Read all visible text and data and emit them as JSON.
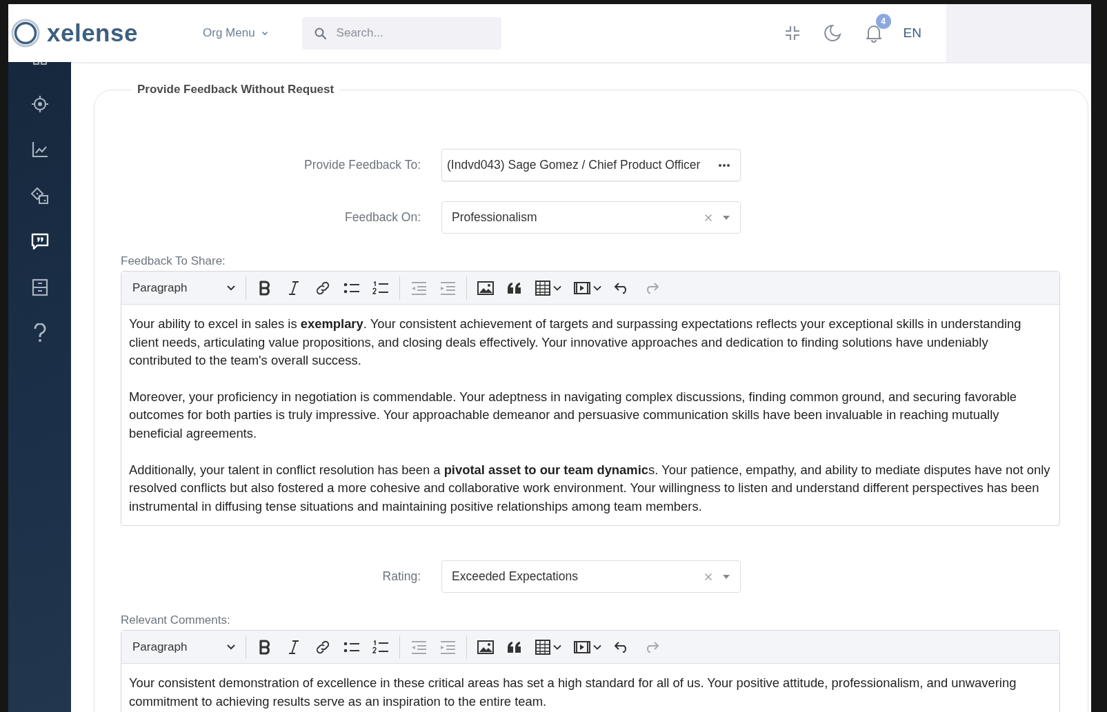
{
  "brand": {
    "name": "xelense"
  },
  "header": {
    "org_menu": "Org Menu",
    "search": {
      "placeholder": "Search..."
    },
    "notifications": {
      "count": "4"
    },
    "language": "EN"
  },
  "sidebar": {
    "items": [
      {
        "kind": "grid",
        "selected": false
      },
      {
        "kind": "target",
        "selected": false
      },
      {
        "kind": "chart",
        "selected": false
      },
      {
        "kind": "shapes",
        "selected": false
      },
      {
        "kind": "feedback",
        "selected": true
      },
      {
        "kind": "archive",
        "selected": false
      },
      {
        "kind": "help",
        "selected": false
      }
    ]
  },
  "form": {
    "title": "Provide Feedback Without Request",
    "rows": [
      {
        "kind": "picker",
        "label": "Provide Feedback To:",
        "value": "(Indvd043) Sage Gomez / Chief Product Officer"
      },
      {
        "kind": "select",
        "label": "Feedback On:",
        "value": "Professionalism"
      },
      {
        "kind": "editor",
        "label": "Feedback To Share:",
        "block_format": "Paragraph",
        "toolbar": [
          {
            "tools": [
              {
                "kind": "bold",
                "disabled": false,
                "dropdown": false
              },
              {
                "kind": "italic",
                "disabled": false,
                "dropdown": false
              },
              {
                "kind": "link",
                "disabled": false,
                "dropdown": false
              },
              {
                "kind": "bulleted-list",
                "disabled": false,
                "dropdown": false
              },
              {
                "kind": "numbered-list",
                "disabled": false,
                "dropdown": false
              }
            ]
          },
          {
            "tools": [
              {
                "kind": "outdent",
                "disabled": true,
                "dropdown": false
              },
              {
                "kind": "indent",
                "disabled": true,
                "dropdown": false
              }
            ]
          },
          {
            "tools": [
              {
                "kind": "image",
                "disabled": false,
                "dropdown": false
              },
              {
                "kind": "quote",
                "disabled": false,
                "dropdown": false
              },
              {
                "kind": "table",
                "disabled": false,
                "dropdown": true
              },
              {
                "kind": "media",
                "disabled": false,
                "dropdown": true
              },
              {
                "kind": "undo",
                "disabled": false,
                "dropdown": false
              },
              {
                "kind": "redo",
                "disabled": true,
                "dropdown": false
              }
            ]
          }
        ],
        "paragraphs": [
          "Your ability to excel in sales is **exemplary**. Your consistent achievement of targets and surpassing expectations reflects your exceptional skills in understanding client needs, articulating value propositions, and closing deals effectively. Your innovative approaches and dedication to finding solutions have undeniably contributed to the team's overall success.",
          "Moreover, your proficiency in negotiation is commendable. Your adeptness in navigating complex discussions, finding common ground, and securing favorable outcomes for both parties is truly impressive. Your approachable demeanor and persuasive communication skills have been invaluable in reaching mutually beneficial agreements.",
          "Additionally, your talent in conflict resolution has been a **pivotal asset to our team dynamic**s. Your patience, empathy, and ability to mediate disputes have not only resolved conflicts but also fostered a more cohesive and collaborative work environment. Your willingness to listen and understand different perspectives has been instrumental in diffusing tense situations and maintaining positive relationships among team members."
        ]
      },
      {
        "kind": "select",
        "label": "Rating:",
        "value": "Exceeded Expectations"
      },
      {
        "kind": "editor",
        "label": "Relevant Comments:",
        "block_format": "Paragraph",
        "toolbar": [
          {
            "tools": [
              {
                "kind": "bold",
                "disabled": false,
                "dropdown": false
              },
              {
                "kind": "italic",
                "disabled": false,
                "dropdown": false
              },
              {
                "kind": "link",
                "disabled": false,
                "dropdown": false
              },
              {
                "kind": "bulleted-list",
                "disabled": false,
                "dropdown": false
              },
              {
                "kind": "numbered-list",
                "disabled": false,
                "dropdown": false
              }
            ]
          },
          {
            "tools": [
              {
                "kind": "outdent",
                "disabled": true,
                "dropdown": false
              },
              {
                "kind": "indent",
                "disabled": true,
                "dropdown": false
              }
            ]
          },
          {
            "tools": [
              {
                "kind": "image",
                "disabled": false,
                "dropdown": false
              },
              {
                "kind": "quote",
                "disabled": false,
                "dropdown": false
              },
              {
                "kind": "table",
                "disabled": false,
                "dropdown": true
              },
              {
                "kind": "media",
                "disabled": false,
                "dropdown": true
              },
              {
                "kind": "undo",
                "disabled": false,
                "dropdown": false
              },
              {
                "kind": "redo",
                "disabled": true,
                "dropdown": false
              }
            ]
          }
        ],
        "paragraphs": [
          "Your consistent demonstration of excellence in these critical areas has set a high standard for all of us. Your positive attitude, professionalism, and unwavering commitment to achieving results serve as an inspiration to the entire team."
        ]
      }
    ]
  }
}
